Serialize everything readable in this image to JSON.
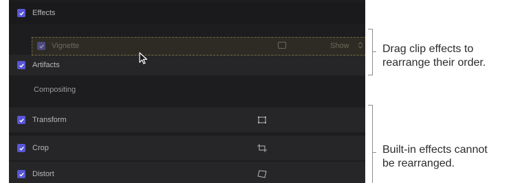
{
  "inspector": {
    "effects_header": "Effects",
    "dragged_effect": {
      "label": "Vignette",
      "icon": "rectangle-icon",
      "option_label": "Show"
    },
    "artifacts_row": "Artifacts",
    "section_title": "Compositing",
    "built_in_effects": [
      {
        "label": "Transform",
        "icon": "transform-icon"
      },
      {
        "label": "Crop",
        "icon": "crop-icon"
      },
      {
        "label": "Distort",
        "icon": "distort-icon"
      }
    ]
  },
  "callouts": {
    "drag": {
      "line1": "Drag clip effects to",
      "line2": "rearrange their order."
    },
    "builtin": {
      "line1": "Built-in effects cannot",
      "line2": "be rearranged."
    }
  },
  "colors": {
    "panel_bg": "#1d1d1f",
    "checkbox_accent": "#5856d6",
    "drag_outline": "#6f6a43"
  }
}
